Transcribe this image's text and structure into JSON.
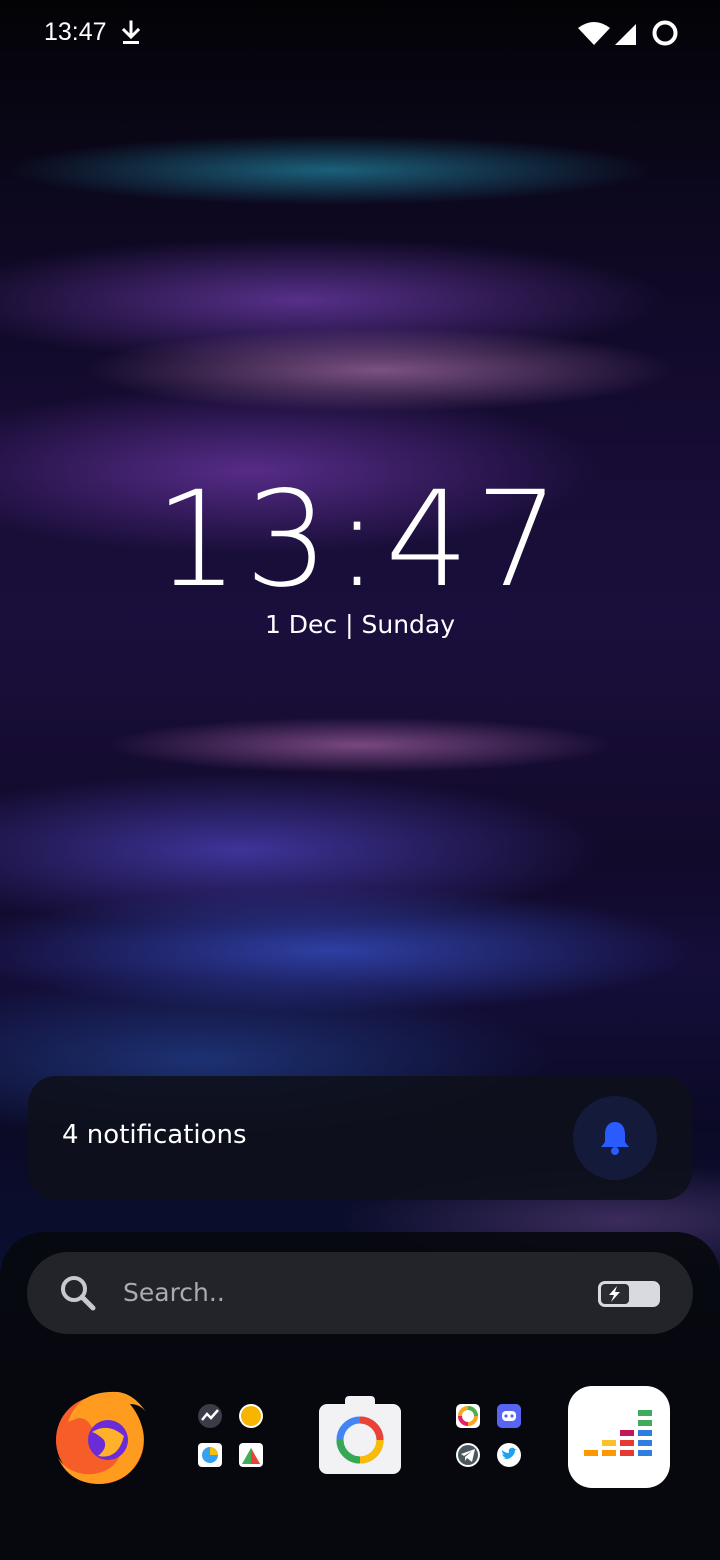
{
  "status_bar": {
    "time": "13:47"
  },
  "lockscreen": {
    "clock": "13:47",
    "date": "1 Dec | Sunday"
  },
  "notifications": {
    "label": "4 notifications"
  },
  "search": {
    "placeholder": "Search.."
  },
  "dock": {
    "apps": [
      "firefox",
      "folder-tools",
      "camera",
      "folder-social",
      "deezer"
    ]
  },
  "colors": {
    "notification_card": "#0e101a",
    "search_bar": "#23242a",
    "bell_accent": "#2a5bff"
  }
}
